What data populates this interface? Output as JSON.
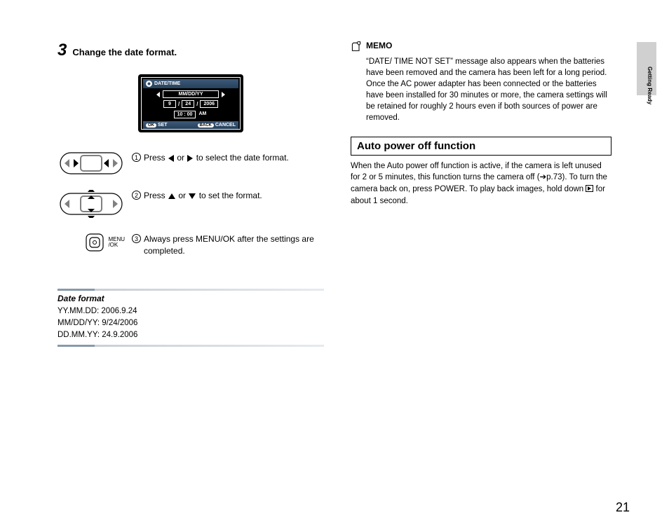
{
  "left": {
    "step_number": "3",
    "step_title": "Change the date format.",
    "lcd": {
      "title": "DATE/TIME",
      "format": "MM/DD/YY",
      "month": "9",
      "day": "24",
      "year": "2006",
      "time": "10 : 00",
      "ampm": "AM",
      "ok_pill": "OK",
      "ok_label": "SET",
      "back_pill": "BACK",
      "back_label": "CANCEL"
    },
    "instr1": {
      "num": "1",
      "pre": "Press ",
      "mid": " or ",
      "post": " to select the date format."
    },
    "instr2": {
      "num": "2",
      "pre": "Press ",
      "mid": " or ",
      "post": " to set the format."
    },
    "instr3": {
      "num": "3",
      "text": "Always press MENU/OK after the settings are completed.",
      "btn_label": "MENU\n/OK"
    },
    "fmt": {
      "title": "Date format",
      "l1": "YY.MM.DD: 2006.9.24",
      "l2": "MM/DD/YY: 9/24/2006",
      "l3": "DD.MM.YY: 24.9.2006"
    }
  },
  "right": {
    "memo_label": "MEMO",
    "memo_p1": "“DATE/ TIME NOT SET” message also appears when the batteries have been removed and the camera has been left for a long period.",
    "memo_p2": "Once the AC power adapter has been connected or the batteries have been installed for 30 minutes or more, the camera settings will be retained for roughly 2 hours even if both sources of power are removed.",
    "section_title": "Auto power off function",
    "body_pre": "When the Auto power off function is active, if the camera is left unused for 2 or 5 minutes, this function turns the camera off (➔p.73). To turn the camera back on, press POWER. To play back images, hold down ",
    "body_post": " for about 1 second."
  },
  "side_label": "Getting Ready",
  "page_number": "21"
}
